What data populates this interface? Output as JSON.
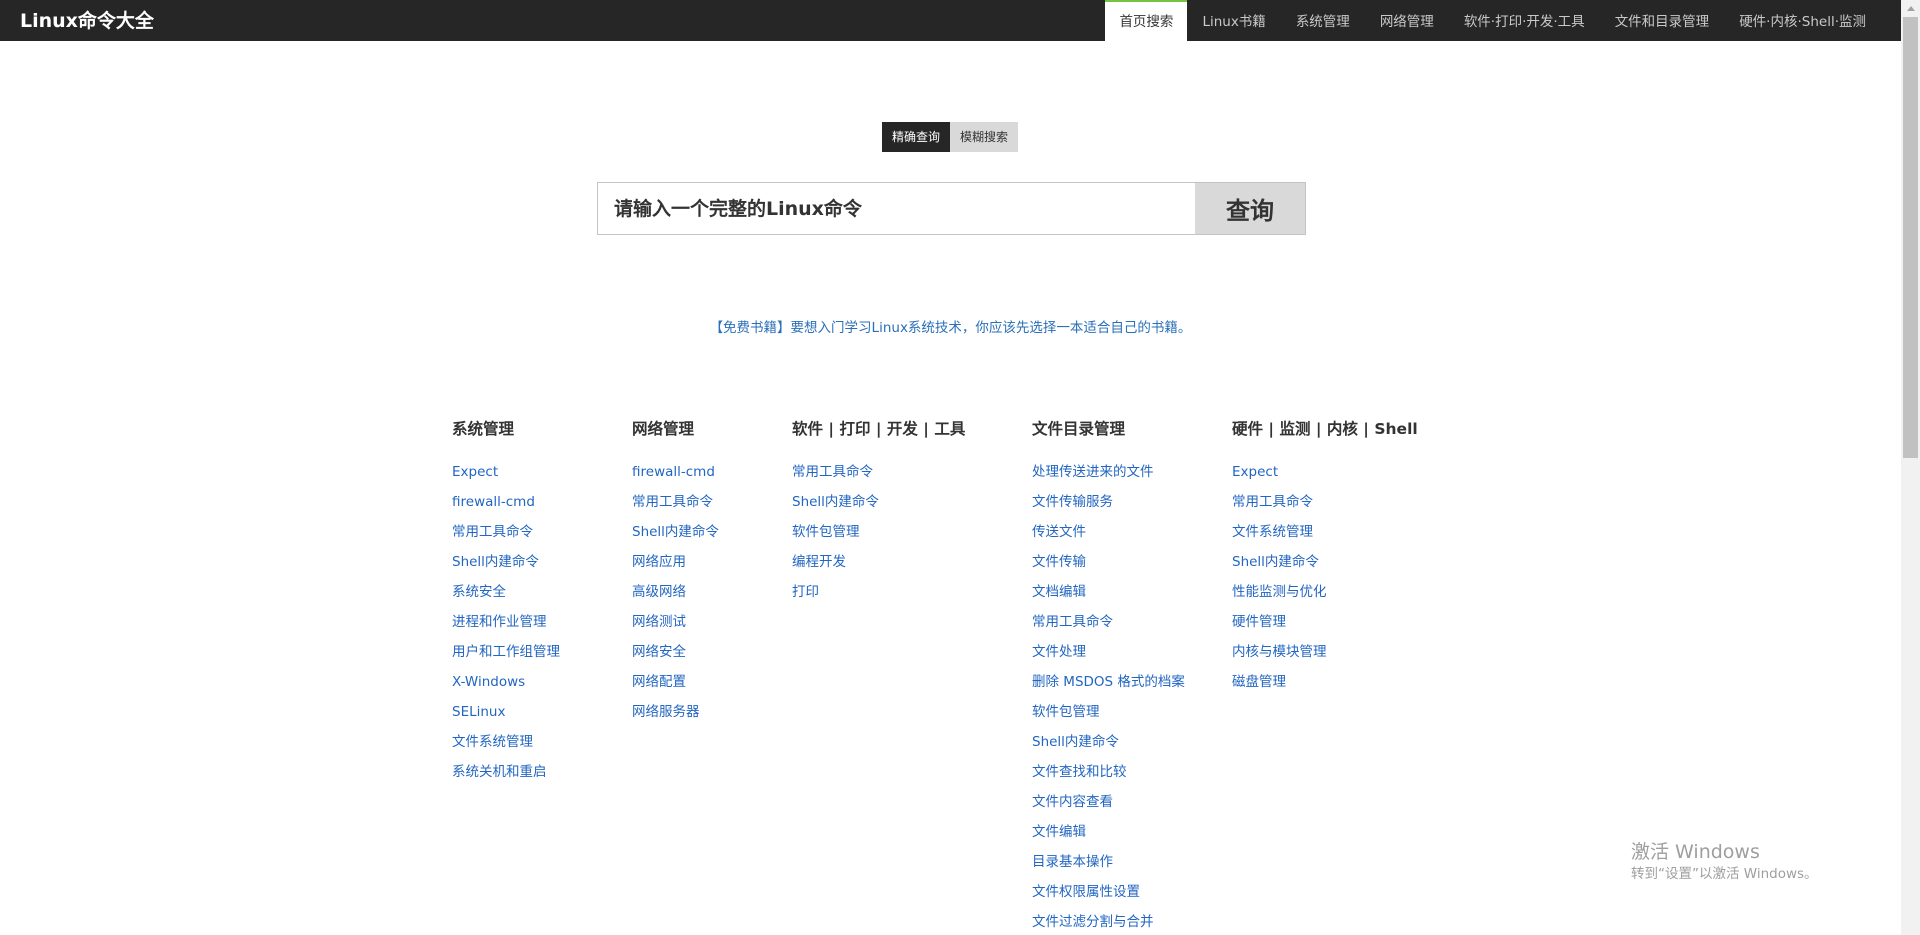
{
  "header": {
    "logo": "Linux命令大全",
    "nav": [
      {
        "label": "首页搜索",
        "active": true
      },
      {
        "label": "Linux书籍"
      },
      {
        "label": "系统管理"
      },
      {
        "label": "网络管理"
      },
      {
        "label": "软件·打印·开发·工具"
      },
      {
        "label": "文件和目录管理"
      },
      {
        "label": "硬件·内核·Shell·监测"
      }
    ]
  },
  "search": {
    "tabs": [
      {
        "label": "精确查询",
        "active": true
      },
      {
        "label": "模糊搜索"
      }
    ],
    "placeholder": "请输入一个完整的Linux命令",
    "button_label": "查询"
  },
  "notice": "【免费书籍】要想入门学习Linux系统技术，你应该先选择一本适合自己的书籍。",
  "categories": [
    {
      "title": "系统管理",
      "links": [
        "Expect",
        "firewall-cmd",
        "常用工具命令",
        "Shell内建命令",
        "系统安全",
        "进程和作业管理",
        "用户和工作组管理",
        "X-Windows",
        "SELinux",
        "文件系统管理",
        "系统关机和重启"
      ]
    },
    {
      "title": "网络管理",
      "links": [
        "firewall-cmd",
        "常用工具命令",
        "Shell内建命令",
        "网络应用",
        "高级网络",
        "网络测试",
        "网络安全",
        "网络配置",
        "网络服务器"
      ]
    },
    {
      "title": "软件 | 打印 | 开发 | 工具",
      "links": [
        "常用工具命令",
        "Shell内建命令",
        "软件包管理",
        "编程开发",
        "打印"
      ]
    },
    {
      "title": "文件目录管理",
      "links": [
        "处理传送进来的文件",
        "文件传输服务",
        "传送文件",
        "文件传输",
        "文档编辑",
        "常用工具命令",
        "文件处理",
        "删除 MSDOS 格式的档案",
        "软件包管理",
        "Shell内建命令",
        "文件查找和比较",
        "文件内容查看",
        "文件编辑",
        "目录基本操作",
        "文件权限属性设置",
        "文件过滤分割与合并"
      ]
    },
    {
      "title": "硬件 | 监测 | 内核 | Shell",
      "links": [
        "Expect",
        "常用工具命令",
        "文件系统管理",
        "Shell内建命令",
        "性能监测与优化",
        "硬件管理",
        "内核与模块管理",
        "磁盘管理"
      ]
    }
  ],
  "watermark": {
    "title": "激活 Windows",
    "subtitle": "转到“设置”以激活 Windows。"
  },
  "colors": {
    "header_bg": "#262626",
    "active_tab_accent": "#77c23f",
    "link": "#2266c2",
    "button_bg": "#d9d9d9"
  }
}
